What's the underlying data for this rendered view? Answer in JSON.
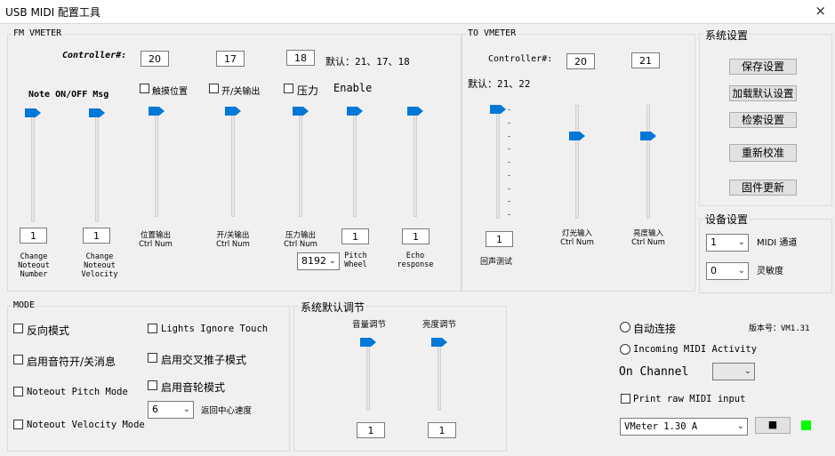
{
  "window": {
    "title": "USB MIDI 配置工具",
    "close_glyph": "×"
  },
  "fm": {
    "group_label": "FM VMETER",
    "controller_label": "Controller#:",
    "controllers": [
      "20",
      "17",
      "18"
    ],
    "default_text": "默认：21、17、18",
    "note_label": "Note ON/OFF Msg",
    "checkbox_touch": "触摸位置",
    "checkbox_switch": "开/关输出",
    "checkbox_pressure": "压力",
    "enable_label": "Enable",
    "fields": [
      "1",
      "1",
      "1",
      "1"
    ],
    "labels": {
      "change_noteout_number": "Change Noteout Number",
      "change_noteout_velocity": "Change Noteout Velocity",
      "pos_out": "位置输出 Ctrl Num",
      "switch_out": "开/关输出 Ctrl Num",
      "pressure_out": "压力输出 Ctrl Num",
      "pitch_wheel": "Pitch Wheel",
      "echo_response": "Echo response"
    },
    "pitch_select": "8192"
  },
  "to": {
    "group_label": "TO VMETER",
    "controller_label": "Controller#:",
    "controllers": [
      "20",
      "21"
    ],
    "default_text": "默认：21、22",
    "echo_field": "1",
    "echo_label": "回声测试",
    "light_label": "灯光输入 Ctrl Num",
    "bright_label": "亮度输入 Ctrl Num"
  },
  "system": {
    "group_label": "系统设置",
    "save": "保存设置",
    "load_default": "加载默认设置",
    "search": "检索设置",
    "recalibrate": "重新校准",
    "firmware": "固件更新"
  },
  "device": {
    "group_label": "设备设置",
    "midi_channel_value": "1",
    "midi_channel_label": "MIDI 通道",
    "sensitivity_value": "0",
    "sensitivity_label": "灵敏度"
  },
  "mode": {
    "group_label": "MODE",
    "reverse": "反向模式",
    "note_switch": "启用音符开/关消息",
    "noteout_pitch": "Noteout Pitch Mode",
    "noteout_velocity": "Noteout Velocity Mode",
    "lights_ignore": "Lights Ignore Touch",
    "crossfader": "启用交叉推子模式",
    "wheel": "启用音轮模式",
    "return_speed_value": "6",
    "return_speed_label": "返回中心速度"
  },
  "sysdefault": {
    "group_label": "系统默认调节",
    "volume_label": "音量调节",
    "brightness_label": "亮度调节",
    "volume_value": "1",
    "brightness_value": "1"
  },
  "conn": {
    "auto_connect": "自动连接",
    "version": "版本号：VM1.31",
    "incoming": "Incoming MIDI Activity",
    "on_channel": "On Channel",
    "print_raw": "Print raw MIDI input",
    "device_select": "VMeter 1.30 A",
    "stop_glyph": "■",
    "led_color": "#00ff00"
  },
  "slider_levels": [
    0.0,
    0.0,
    0.0,
    0.0,
    0.0,
    0.0,
    0.0,
    0.0,
    0.25,
    0.25,
    0.0,
    0.0
  ]
}
